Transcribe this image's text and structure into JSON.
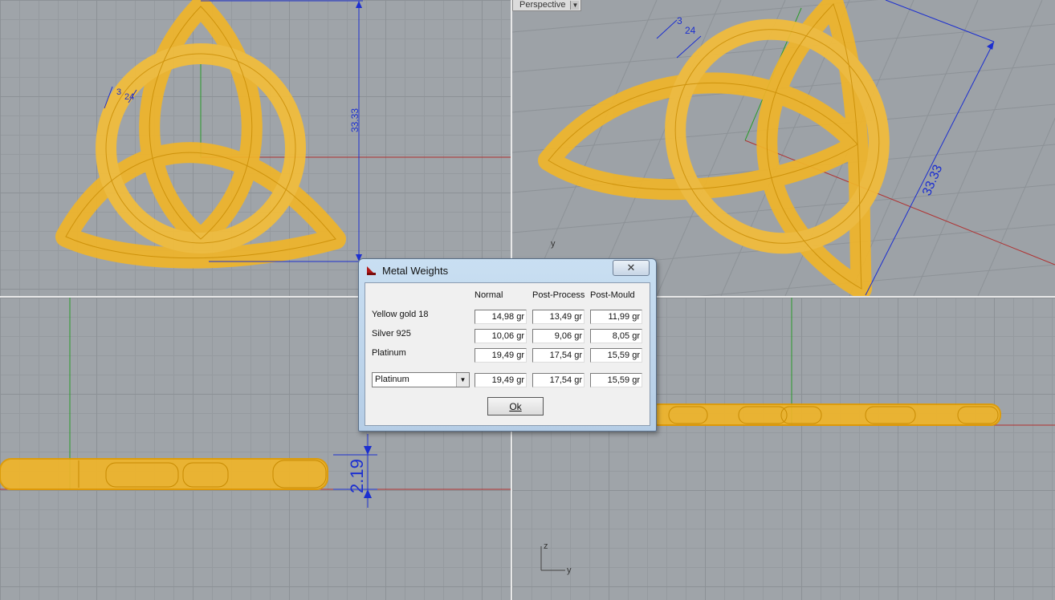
{
  "viewports": {
    "top": {
      "dimension_label": "33.33",
      "small_dim_1": "3",
      "small_dim_2": "24"
    },
    "perspective": {
      "tab_label": "Perspective",
      "dimension_label": "33.33",
      "small_dim_1": "3",
      "small_dim_2": "24",
      "axis_y": "y"
    },
    "front": {
      "dimension_label": "2.19"
    },
    "right": {
      "axis_z": "z",
      "axis_y": "y"
    }
  },
  "dialog": {
    "title": "Metal Weights",
    "close_glyph": "✕",
    "columns": [
      "Normal",
      "Post-Process",
      "Post-Mould"
    ],
    "rows": [
      {
        "label": "Yellow gold 18",
        "values": [
          "14,98 gr",
          "13,49 gr",
          "11,99 gr"
        ]
      },
      {
        "label": "Silver 925",
        "values": [
          "10,06 gr",
          "9,06 gr",
          "8,05 gr"
        ]
      },
      {
        "label": "Platinum",
        "values": [
          "19,49 gr",
          "17,54 gr",
          "15,59 gr"
        ]
      }
    ],
    "selector": {
      "selected": "Platinum",
      "values": [
        "19,49 gr",
        "17,54 gr",
        "15,59 gr"
      ]
    },
    "ok_label": "Ok"
  },
  "colors": {
    "object": "#f2b51a",
    "object_edge": "#e8a400",
    "dimension": "#1c2fd0",
    "x_axis": "#b03030",
    "y_axis": "#2a9a2a"
  }
}
